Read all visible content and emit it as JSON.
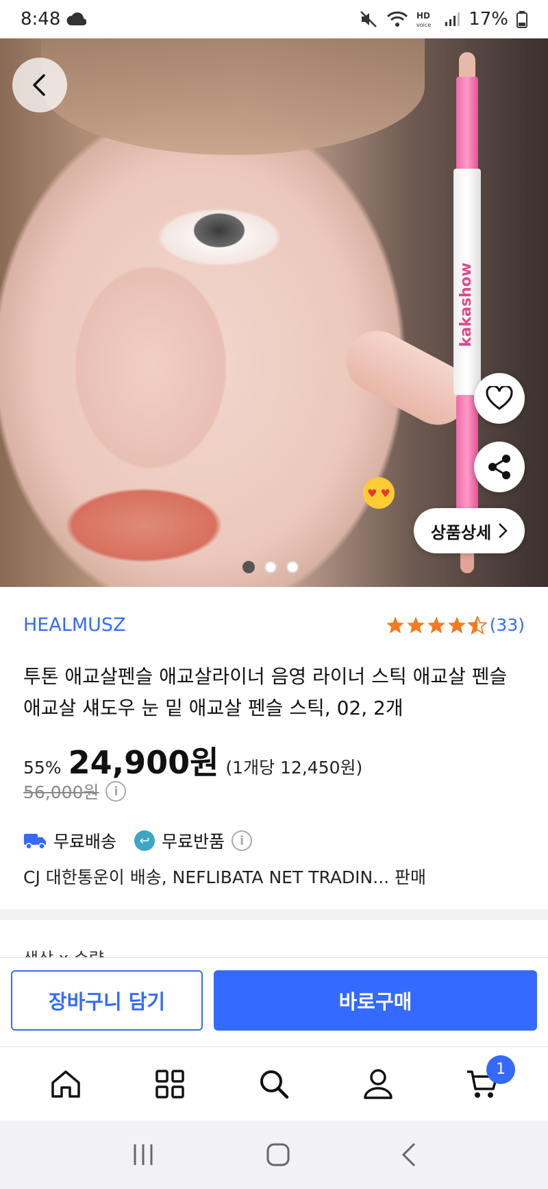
{
  "status_bar": {
    "time": "8:48",
    "battery": "17%"
  },
  "hero": {
    "pencil_brand": "kakashow",
    "carousel_total": 3,
    "carousel_active": 1,
    "detail_button": "상품상세"
  },
  "product": {
    "brand": "HEALMUSZ",
    "rating_stars": 4.5,
    "review_count": "(33)",
    "title": "투톤 애교살펜슬 애교살라이너 음영 라이너 스틱 애교살 펜슬 애교살 섀도우 눈 밑 애교살 펜슬 스틱, 02, 2개",
    "discount": "55%",
    "price": "24,900원",
    "unit_price": "(1개당 12,450원)",
    "original_price": "56,000원",
    "free_shipping": "무료배송",
    "free_return": "무료반품",
    "seller_line": "CJ 대한통운이 배송, NEFLIBATA NET TRADIN... 판매",
    "options_peek": "색상 x 수량"
  },
  "actions": {
    "cart": "장바구니 담기",
    "buy": "바로구매"
  },
  "bottom_nav": {
    "cart_badge": "1"
  },
  "colors": {
    "accent": "#346aff",
    "star": "#f47a20",
    "return": "#3ba7c4"
  }
}
